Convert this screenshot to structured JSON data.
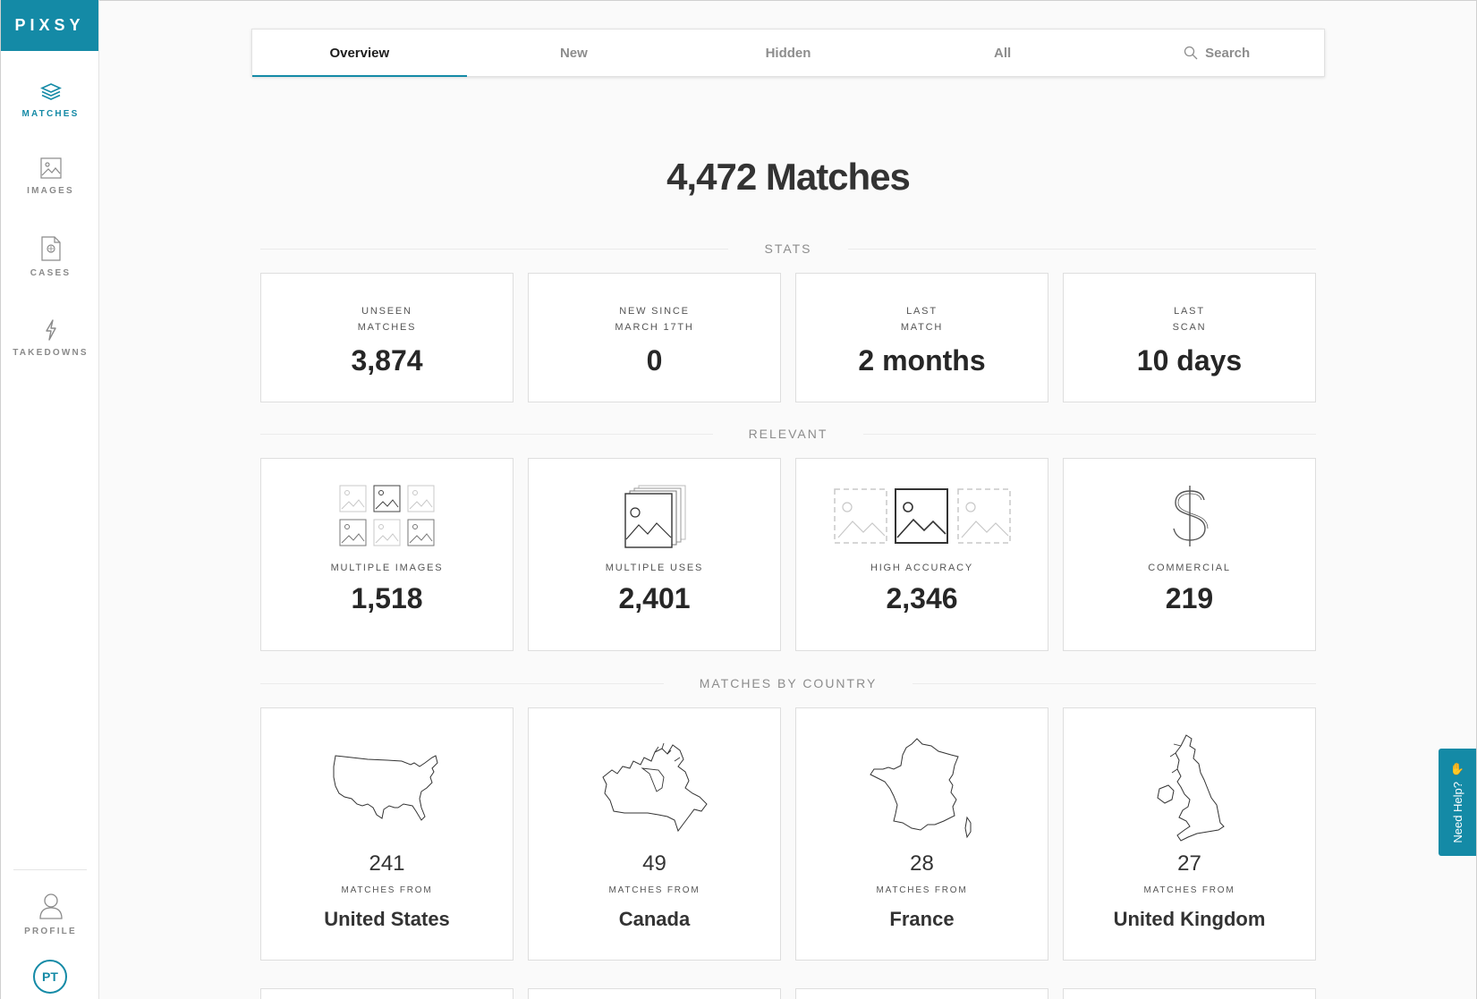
{
  "brand": {
    "logo": "PIXSY",
    "accent": "#148aa6"
  },
  "sidebar": {
    "items": [
      {
        "label": "MATCHES",
        "icon": "layers-icon",
        "active": true
      },
      {
        "label": "IMAGES",
        "icon": "image-icon",
        "active": false
      },
      {
        "label": "CASES",
        "icon": "case-file-icon",
        "active": false
      },
      {
        "label": "TAKEDOWNS",
        "icon": "lightning-icon",
        "active": false
      }
    ],
    "profile": {
      "label": "PROFILE",
      "icon": "person-icon"
    },
    "avatar_initials": "PT"
  },
  "tabs": [
    {
      "label": "Overview",
      "active": true
    },
    {
      "label": "New",
      "active": false
    },
    {
      "label": "Hidden",
      "active": false
    },
    {
      "label": "All",
      "active": false
    },
    {
      "label": "Search",
      "active": false,
      "icon": "search-icon"
    }
  ],
  "main": {
    "title": "4,472 Matches",
    "stats_section": "STATS",
    "stats": [
      {
        "label_line1": "UNSEEN",
        "label_line2": "MATCHES",
        "value": "3,874"
      },
      {
        "label_line1": "NEW SINCE",
        "label_line2": "MARCH 17TH",
        "value": "0"
      },
      {
        "label_line1": "LAST",
        "label_line2": "MATCH",
        "value": "2 months"
      },
      {
        "label_line1": "LAST",
        "label_line2": "SCAN",
        "value": "10 days"
      }
    ],
    "relevant_section": "RELEVANT",
    "relevant": [
      {
        "label": "MULTIPLE IMAGES",
        "value": "1,518",
        "icon": "image-grid-icon"
      },
      {
        "label": "MULTIPLE USES",
        "value": "2,401",
        "icon": "image-stack-icon"
      },
      {
        "label": "HIGH ACCURACY",
        "value": "2,346",
        "icon": "image-highlight-icon"
      },
      {
        "label": "COMMERCIAL",
        "value": "219",
        "icon": "dollar-icon"
      }
    ],
    "country_section": "MATCHES BY COUNTRY",
    "countries": [
      {
        "count": "241",
        "from_label": "MATCHES FROM",
        "name": "United States",
        "icon": "usa-map-icon"
      },
      {
        "count": "49",
        "from_label": "MATCHES FROM",
        "name": "Canada",
        "icon": "canada-map-icon"
      },
      {
        "count": "28",
        "from_label": "MATCHES FROM",
        "name": "France",
        "icon": "france-map-icon"
      },
      {
        "count": "27",
        "from_label": "MATCHES FROM",
        "name": "United Kingdom",
        "icon": "uk-map-icon"
      }
    ]
  },
  "help": {
    "label": "Need Help?",
    "icon": "waving-hand-icon"
  }
}
